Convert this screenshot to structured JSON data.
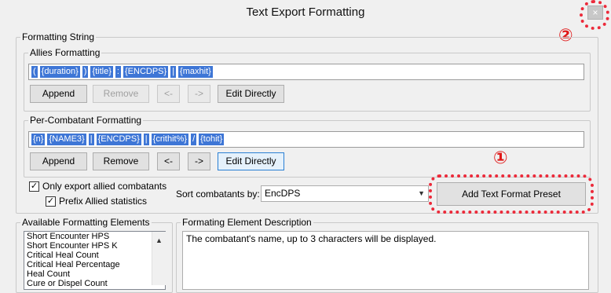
{
  "window": {
    "title": "Text Export Formatting",
    "close_glyph": "×"
  },
  "annotations": {
    "marker_1": "①",
    "marker_2": "②",
    "highlight_color": "#ec2a3a"
  },
  "formatting_string": {
    "label": "Formatting String",
    "allies": {
      "label": "Allies Formatting",
      "tokens": [
        "(",
        "{duration}",
        ")",
        "{title}",
        ":",
        "{ENCDPS}",
        "|",
        "{maxhit}"
      ],
      "buttons": {
        "append": "Append",
        "remove": "Remove",
        "left": "<-",
        "right": "->",
        "edit": "Edit Directly"
      }
    },
    "per_combatant": {
      "label": "Per-Combatant Formatting",
      "tokens": [
        "{n}",
        "{NAME3}",
        "|",
        "{ENCDPS}",
        "|",
        "{crithit%}",
        "/",
        "{tohit}"
      ],
      "buttons": {
        "append": "Append",
        "remove": "Remove",
        "left": "<-",
        "right": "->",
        "edit": "Edit Directly"
      }
    },
    "options": {
      "only_allied": {
        "label": "Only export allied combatants",
        "checked": true
      },
      "prefix_allied": {
        "label": "Prefix Allied statistics",
        "checked": true
      }
    },
    "sort": {
      "label": "Sort combatants by:",
      "value": "EncDPS"
    },
    "add_preset_button": "Add Text Format Preset"
  },
  "elements": {
    "label": "Available Formatting Elements",
    "items": [
      "Short Encounter HPS",
      "Short Encounter HPS K",
      "Critical Heal Count",
      "Critical Heal Percentage",
      "Heal Count",
      "Cure or Dispel Count"
    ]
  },
  "description": {
    "label": "Formating Element Description",
    "text": "The combatant's name, up to 3 characters will be displayed."
  },
  "colors": {
    "token_bg": "#3e76d6",
    "window_bg": "#f0f0f0"
  }
}
